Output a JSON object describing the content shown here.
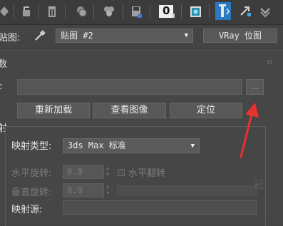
{
  "toolbar": {
    "icons": [
      "diamond-icon",
      "put-to-scene-icon",
      "delete-icon",
      "material-to-unique-icon",
      "shader-ball-icon",
      "save-icon",
      "material-id-channel-icon",
      "show-map-icon",
      "show-end-result-icon",
      "go-to-parent-icon",
      "go-forward-icon"
    ],
    "material_id": "0"
  },
  "map_row": {
    "label": "贴图:",
    "map_name": "贴图 #2",
    "map_type_button": "VRay 位图"
  },
  "section_title": "数",
  "file": {
    "label": ":",
    "path_value": "",
    "browse_label": "..."
  },
  "buttons": {
    "reload": "重新加载",
    "view_image": "查看图像",
    "locate": "定位"
  },
  "group_marker": "射",
  "mapping": {
    "type_label": "映射类型:",
    "type_value": "3ds Max 标准",
    "h_rotation_label": "水平旋转:",
    "h_rotation_value": "0.0",
    "h_flip_label": "水平翻转",
    "v_rotation_label": "垂直旋转:",
    "v_rotation_value": "0.0",
    "source_label": "映射源:",
    "source_value": ""
  },
  "watermark": "冠",
  "colors": {
    "annotation_arrow": "#e8322e",
    "active_icon": "#4aa7e6"
  }
}
